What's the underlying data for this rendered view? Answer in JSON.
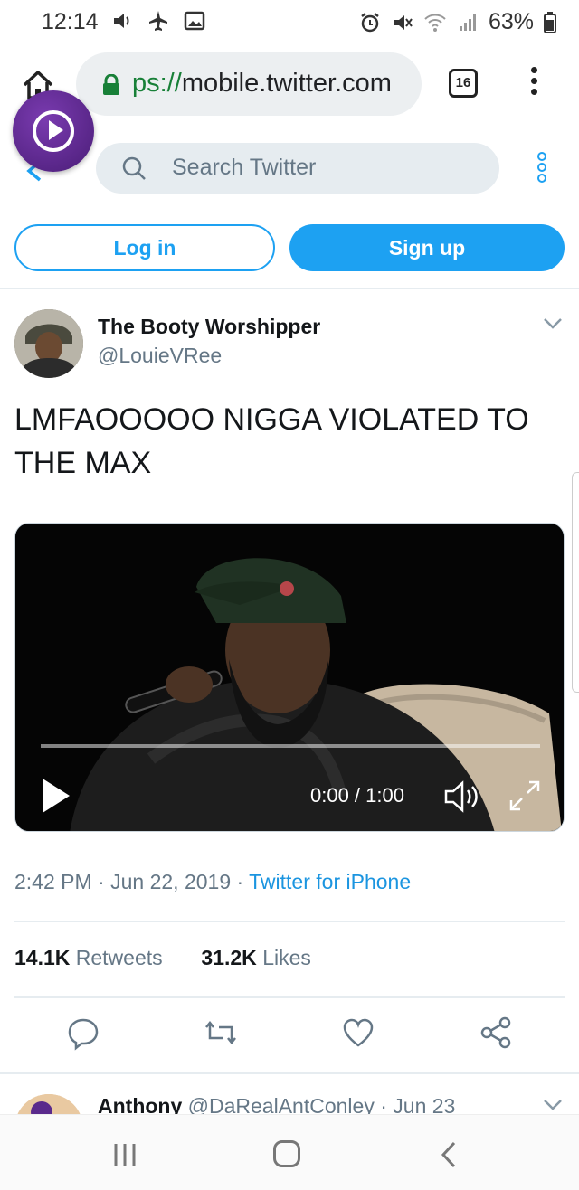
{
  "status_bar": {
    "time": "12:14",
    "battery": "63%"
  },
  "browser": {
    "url_scheme": "ps://",
    "url_host": "mobile.twitter.com",
    "tab_count": "16"
  },
  "search": {
    "placeholder": "Search Twitter"
  },
  "auth": {
    "login_label": "Log in",
    "signup_label": "Sign up"
  },
  "tweet": {
    "display_name": "The Booty Worshipper",
    "handle": "@LouieVRee",
    "text": "LMFAOOOOO NIGGA VIOLATED TO THE MAX",
    "video": {
      "time": "0:00 / 1:00",
      "progress": 0
    },
    "time": "2:42 PM",
    "date": "Jun 22, 2019",
    "source": "Twitter for iPhone",
    "retweets_count": "14.1K",
    "retweets_label": "Retweets",
    "likes_count": "31.2K",
    "likes_label": "Likes"
  },
  "next_tweet": {
    "display_name": "Anthony",
    "handle": "@DaRealAntConley",
    "date": "Jun 23"
  },
  "colors": {
    "twitter_blue": "#1da1f2",
    "text_gray": "#657786",
    "bubble_purple": "#5a2a8c"
  }
}
